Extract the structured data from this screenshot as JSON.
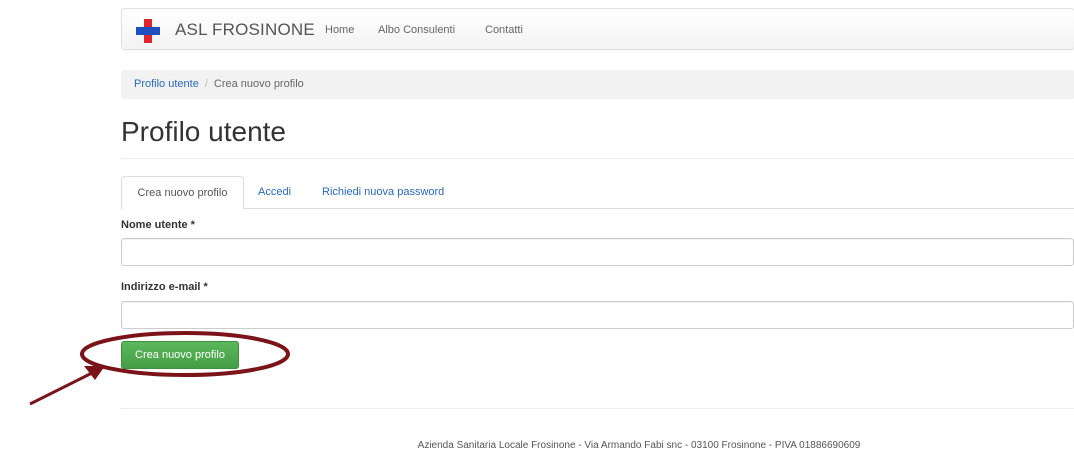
{
  "navbar": {
    "brand": "ASL FROSINONE",
    "links": [
      "Home",
      "Albo Consulenti",
      "Contatti"
    ]
  },
  "breadcrumb": {
    "parent": "Profilo utente",
    "separator": "/",
    "current": "Crea nuovo profilo"
  },
  "page": {
    "title": "Profilo utente"
  },
  "tabs": [
    "Crea nuovo profilo",
    "Accedi",
    "Richiedi nuova password"
  ],
  "form": {
    "username_label": "Nome utente *",
    "username_value": "",
    "email_label": "Indirizzo e-mail *",
    "email_value": "",
    "submit_label": "Crea nuovo profilo"
  },
  "footer": {
    "text": "Azienda Sanitaria Locale Frosinone - Via Armando Fabi snc - 03100 Frosinone - PIVA 01886690609"
  },
  "colors": {
    "link": "#2a6ab8",
    "button": "#5cb85c",
    "annotation": "#7a1418",
    "logo_red": "#e0232d",
    "logo_blue": "#1e4fbf"
  }
}
